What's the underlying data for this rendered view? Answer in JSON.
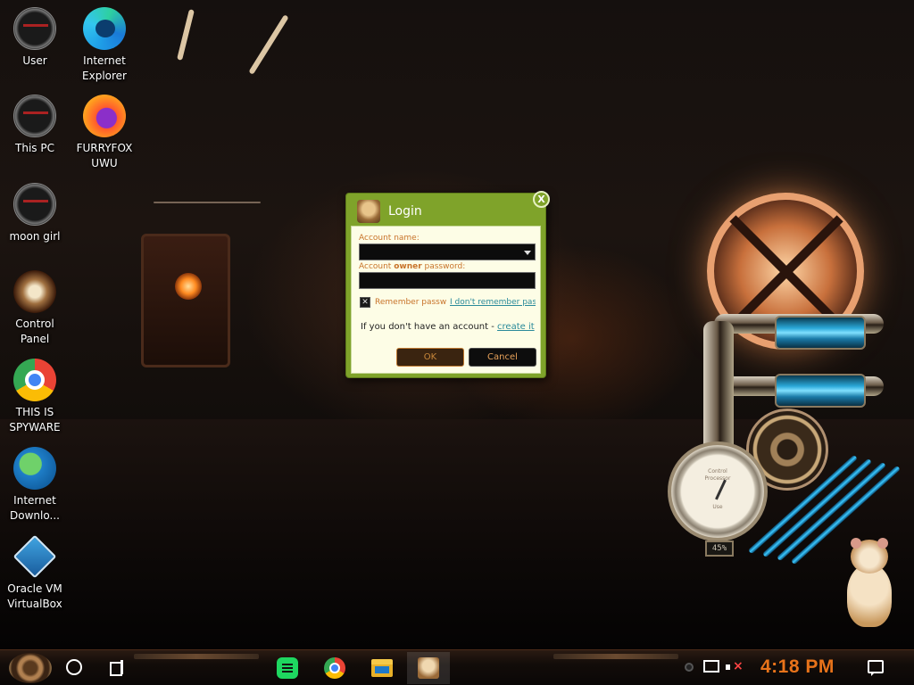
{
  "desktop": {
    "icons": [
      {
        "label": "User",
        "icon": "gauge-icon"
      },
      {
        "label": "Internet\nExplorer",
        "icon": "edge-icon"
      },
      {
        "label": "This PC",
        "icon": "gauge-icon"
      },
      {
        "label": "FURRYFOX\nUWU",
        "icon": "firefox-icon"
      },
      {
        "label": "moon girl",
        "icon": "gauge-icon"
      },
      {
        "label": "Control Panel",
        "icon": "lightbulb-icon"
      },
      {
        "label": "THIS IS\nSPYWARE",
        "icon": "chrome-icon"
      },
      {
        "label": "Internet\nDownlo...",
        "icon": "idm-icon"
      },
      {
        "label": "Oracle VM\nVirtualBox",
        "icon": "virtualbox-icon"
      }
    ]
  },
  "login_dialog": {
    "title": "Login",
    "close_label": "X",
    "account_name_label": "Account name:",
    "password_label_prefix": "Account ",
    "password_label_bold": "owner",
    "password_label_suffix": " password:",
    "account_name_value": "",
    "password_value": "",
    "remember_label": "Remember passw",
    "remember_checked": true,
    "forgot_link": "I don't remember pas",
    "signup_text": "If you don't have an account - ",
    "signup_link": "create it",
    "ok_label": "OK",
    "cancel_label": "Cancel",
    "colors": {
      "frame": "#7fa32a",
      "body": "#fdfde6",
      "label": "#c8732a",
      "link": "#2a8a9a"
    }
  },
  "widget": {
    "gauge_text_top": "Control",
    "gauge_text_mid": "Processor",
    "gauge_text_bottom": "Use",
    "cpu_percent": "45%"
  },
  "taskbar": {
    "pinned_apps": [
      "spotify-icon",
      "chrome-icon",
      "file-explorer-icon",
      "hamster-app-icon"
    ],
    "active_app": "hamster-app-icon",
    "clock": "4:18 PM",
    "clock_color": "#e8731a",
    "volume_muted": true
  }
}
